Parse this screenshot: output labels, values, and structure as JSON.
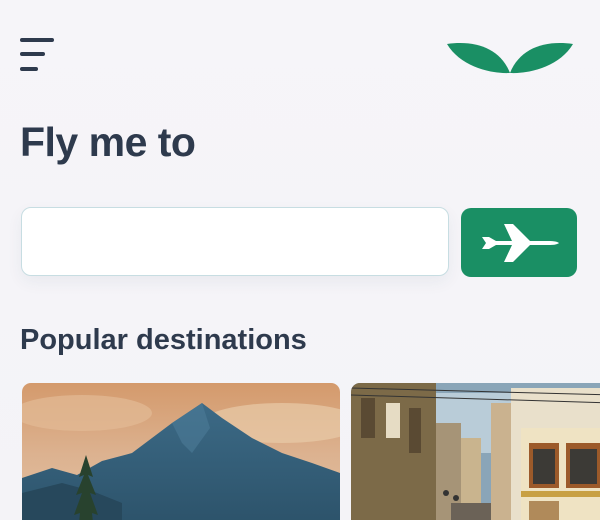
{
  "header": {
    "menu_icon": "hamburger-menu-icon",
    "logo_icon": "wing-logo-icon",
    "brand_color": "#1a8f64"
  },
  "main": {
    "title": "Fly me to",
    "search": {
      "value": "",
      "placeholder": ""
    },
    "go_button_icon": "airplane-icon",
    "popular_title": "Popular destinations",
    "destinations": [
      {
        "image": "mountain-landscape"
      },
      {
        "image": "tram-city-street"
      }
    ]
  }
}
